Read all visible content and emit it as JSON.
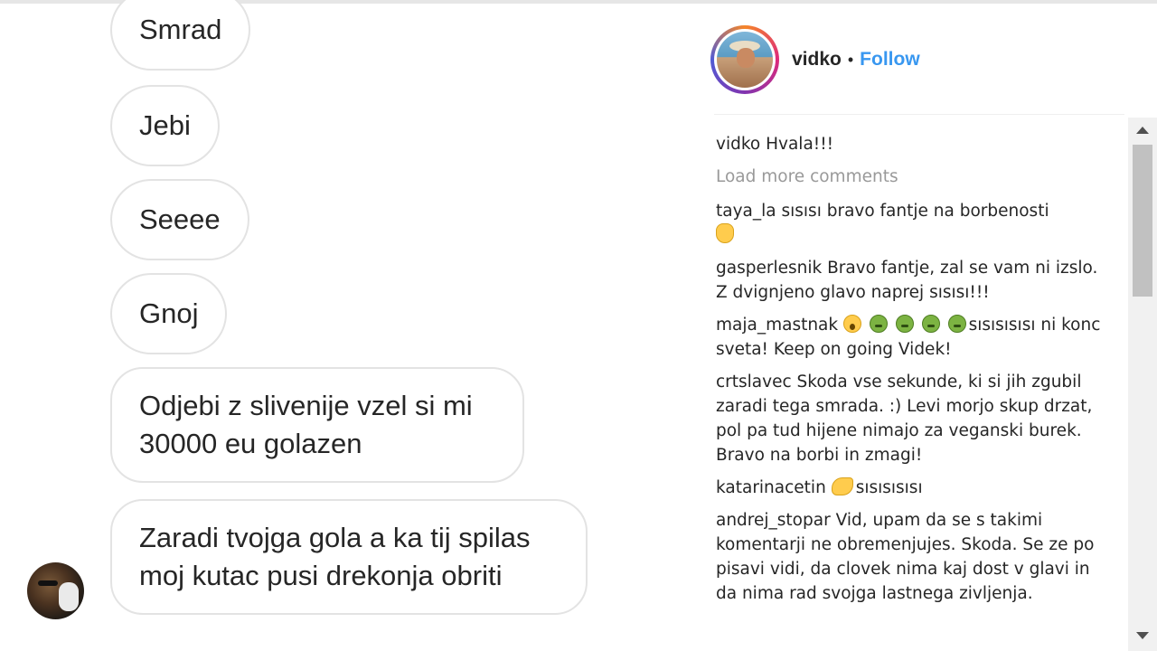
{
  "chat": {
    "messages": [
      "Smrad",
      "Jebi",
      "Seeee",
      "Gnoj",
      "Odjebi z slivenije vzel si mi 30000 eu golazen",
      "Zaradi tvojga gola a ka tij spilas moj kutac pusi drekonja obriti"
    ]
  },
  "post": {
    "username": "vidko",
    "separator": "•",
    "follow_label": "Follow"
  },
  "comments": {
    "caption": {
      "user": "vidko",
      "text": "Hvala!!!"
    },
    "load_more": "Load more comments",
    "items": [
      {
        "user": "taya_la",
        "text": "sısısı bravo fantje na borbenosti"
      },
      {
        "user": "gasperlesnik",
        "text": "Bravo fantje, zal se vam ni izslo. Z dvignjeno glavo naprej sısısı!!!"
      },
      {
        "user": "maja_mastnak",
        "text": "sısısısısı ni konc sveta! Keep on going Videk!"
      },
      {
        "user": "crtslavec",
        "text": "Skoda vse sekunde, ki si jih zgubil zaradi tega smrada. :) Levi morjo skup drzat, pol pa tud hijene nimajo za veganski burek. Bravo na borbi in zmagi!"
      },
      {
        "user": "katarinacetin",
        "text": "sısısısısı"
      },
      {
        "user": "andrej_stopar",
        "text": "Vid, upam da se s takimi komentarji ne obremenjujes. Skoda. Se ze po pisavi vidi, da clovek nima kaj dost v glavi in da nima rad svojga lastnega zivljenja."
      }
    ]
  },
  "icons": {
    "clap": "clapping-hands-icon",
    "shock": "astonished-face-icon",
    "nauseated": "nauseated-face-icon",
    "muscle": "flexed-biceps-icon"
  },
  "colors": {
    "follow": "#3897f0",
    "muted": "#999999",
    "bubble_border": "#e3e3e3"
  }
}
